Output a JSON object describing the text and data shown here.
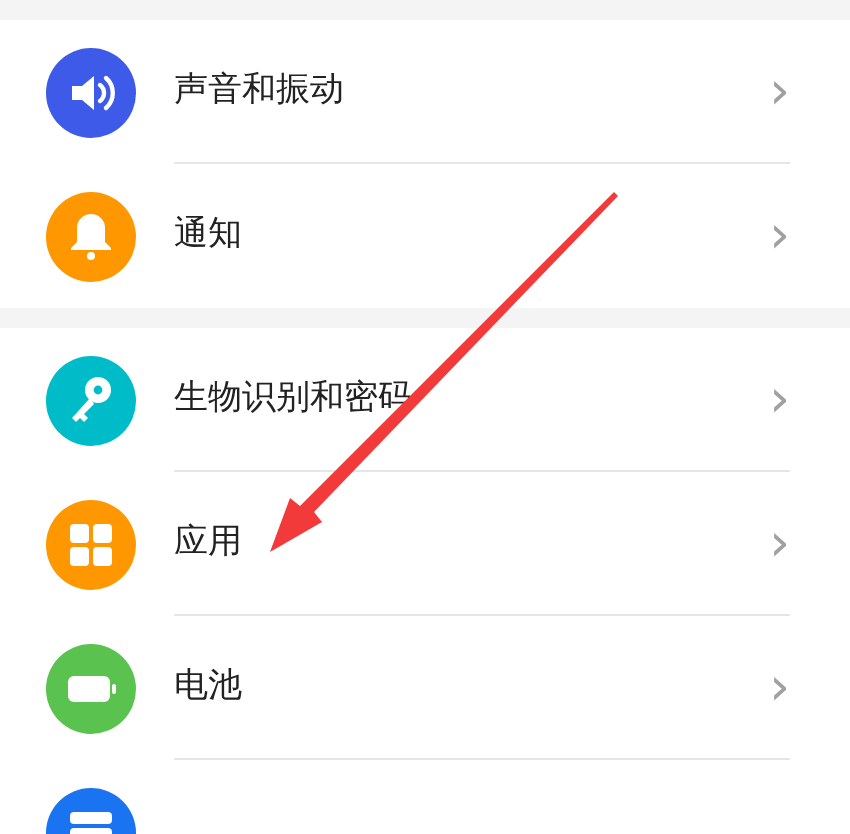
{
  "groups": [
    {
      "items": [
        {
          "label": "声音和振动",
          "color": "#3d5ae8",
          "chevron": "›"
        },
        {
          "label": "通知",
          "color": "#ff9800",
          "chevron": "›"
        }
      ]
    },
    {
      "items": [
        {
          "label": "生物识别和密码",
          "color": "#00bcc8",
          "chevron": "›"
        },
        {
          "label": "应用",
          "color": "#ff9800",
          "chevron": "›"
        },
        {
          "label": "电池",
          "color": "#5ac34f",
          "chevron": "›"
        },
        {
          "color": "#1a73f0"
        }
      ]
    }
  ],
  "annotations": [
    {
      "kind": "arrow"
    }
  ]
}
